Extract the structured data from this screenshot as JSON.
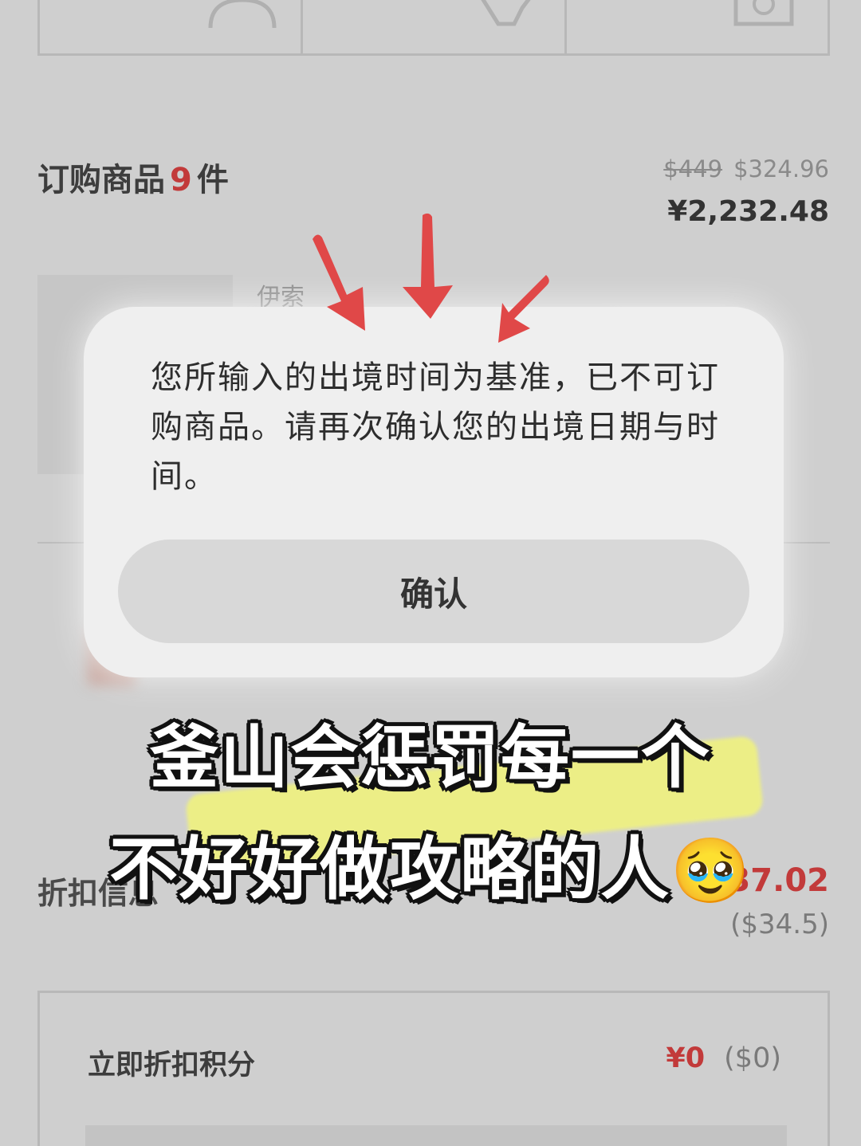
{
  "order": {
    "title_prefix": "订购商品",
    "count": "9",
    "title_suffix": "件",
    "original_price_usd": "$449",
    "price_usd": "$324.96",
    "price_cny": "¥2,232.48",
    "brand": "伊索"
  },
  "dialog": {
    "message": "您所输入的出境时间为基准，已不可订购商品。请再次确认您的出境日期与时间。",
    "confirm_label": "确认"
  },
  "discount": {
    "label": "折扣信息",
    "amount_cny": "¥237.02",
    "amount_usd": "($34.5)"
  },
  "points": {
    "label": "立即折扣积分",
    "value_cny": "¥0",
    "value_usd": "($0)"
  },
  "caption": {
    "line1": "釜山会惩罚每一个",
    "line2": "不好好做攻略的人",
    "emoji": "🥹"
  },
  "colors": {
    "accent_red": "#c23a3a",
    "arrow_red": "#e04848",
    "highlight_yellow": "#f2f47a"
  }
}
